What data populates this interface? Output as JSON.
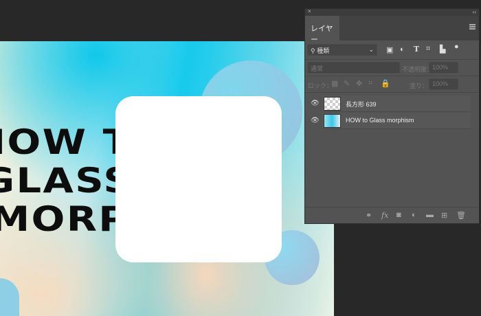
{
  "canvas": {
    "lines": [
      "HOW TO",
      "GLASS",
      "MORPHISM"
    ]
  },
  "panel": {
    "close_icon": "×",
    "collapse_icon": "‹‹",
    "tab": "レイヤー",
    "filter": {
      "label": "種類",
      "chevron": "⌄"
    },
    "blend_mode": "通常",
    "opacity_label": "不透明度：",
    "opacity": "100%",
    "lock_label": "ロック：",
    "fill_label": "塗り：",
    "fill": "100%",
    "layers": [
      {
        "name": "長方形 639"
      },
      {
        "name": "HOW to Glass morphism"
      }
    ],
    "bottom_icons": [
      "link",
      "fx",
      "mask",
      "adjustment",
      "folder",
      "new-layer",
      "trash"
    ],
    "fx_label": "fx"
  }
}
